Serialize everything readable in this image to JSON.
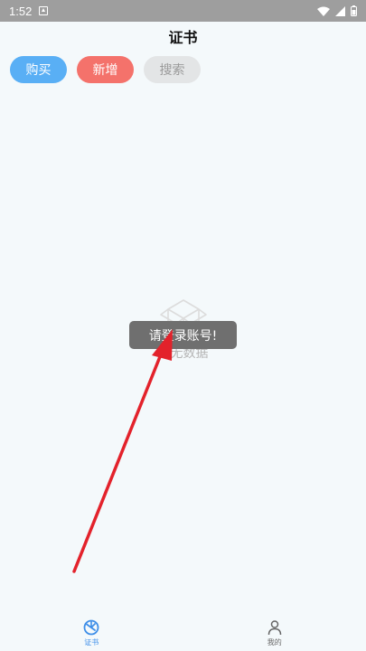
{
  "status_bar": {
    "time": "1:52",
    "icons": [
      "notification-icon",
      "wifi-icon",
      "signal-icon",
      "battery-icon"
    ]
  },
  "header": {
    "title": "证书"
  },
  "actions": {
    "buy_label": "购买",
    "add_label": "新增",
    "search_label": "搜索"
  },
  "empty_state": {
    "icon": "empty-box-icon",
    "text": "暂无数据"
  },
  "toast": {
    "text": "请登录账号!"
  },
  "bottom_nav": {
    "items": [
      {
        "label": "证书",
        "icon": "certificate-icon",
        "active": true
      },
      {
        "label": "我的",
        "icon": "user-icon",
        "active": false
      }
    ]
  },
  "colors": {
    "buy": "#59aff5",
    "add": "#f4726b",
    "search": "#e3e5e6",
    "accent": "#3d8ee8",
    "toast": "#6f6f6f",
    "arrow": "#e3222b"
  }
}
